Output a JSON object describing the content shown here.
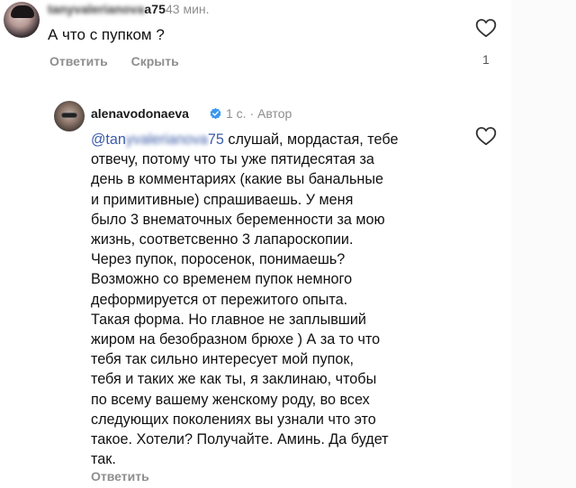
{
  "top_comment": {
    "username_hidden": "tanyvalerianova",
    "username_visible_suffix": "a75",
    "time": "43 мин.",
    "text": "А что с пупком ?",
    "actions": {
      "reply": "Ответить",
      "hide": "Скрыть"
    },
    "like_count": "1"
  },
  "reply": {
    "username": "alenavodonaeva",
    "meta": "1 с. · Автор",
    "mention_visible": "@tan",
    "mention_hidden": "yvalerianova",
    "mention_suffix": "75",
    "lines": [
      "слушай, мордастая, тебе",
      "отвечу, потому что ты уже пятидесятая за",
      "день в комментариях  (какие вы банальные",
      "и примитивные) спрашиваешь. У меня",
      "было 3 внематочных беременности за мою",
      "жизнь, соответсвенно 3 лапароскопии.",
      "Через пупок, поросенок, понимаешь?",
      "Возможно со временем пупок немного",
      "деформируется от пережитого опыта.",
      "Такая форма. Но главное не заплывший",
      "жиром на безобразном брюхе ) А за то что",
      "тебя так сильно интересует мой пупок,",
      "тебя и таких же как ты, я заклинаю, чтобы",
      "по всему вашему женскому роду, во всех",
      "следующих поколениях вы узнали что это",
      "такое. Хотели? Получайте. Аминь. Да будет",
      "так."
    ],
    "reply_action": "Ответить"
  },
  "icons": {
    "like": "heart-outline-icon",
    "verified": "verified-badge-icon"
  },
  "colors": {
    "mention": "#3b5ba8",
    "verified": "#3897f0",
    "muted": "#8e8e8e"
  }
}
